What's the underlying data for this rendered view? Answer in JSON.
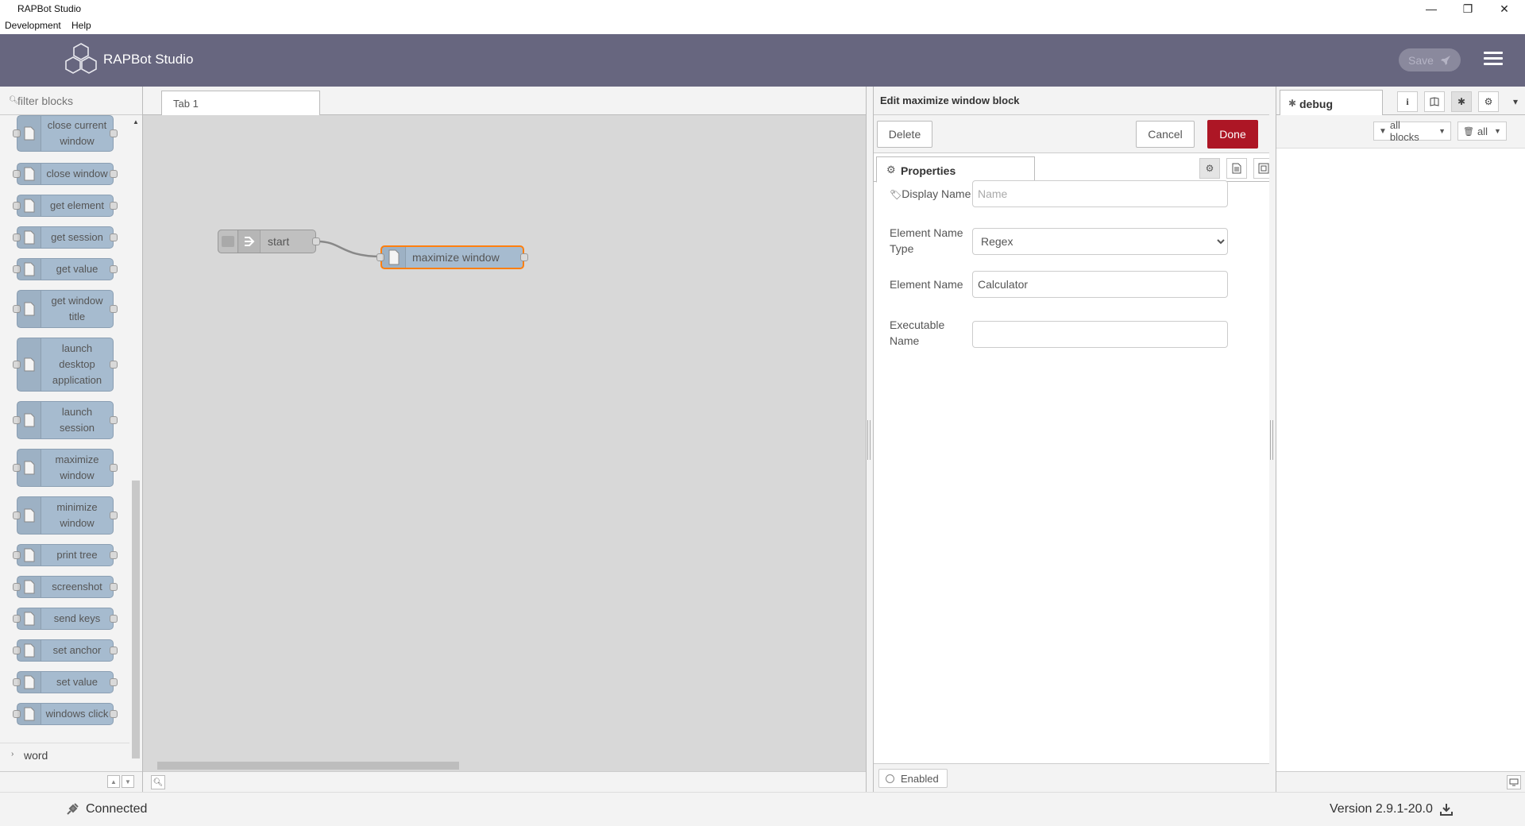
{
  "window": {
    "title": "RAPBot Studio",
    "minimize_glyph": "—",
    "restore_glyph": "❐",
    "close_glyph": "✕"
  },
  "menu": {
    "items": [
      "Development",
      "Help"
    ]
  },
  "header": {
    "app_name": "RAPBot Studio",
    "save_label": "Save",
    "icons": {
      "logo": "hexagon-logo-icon",
      "save": "rocket-icon",
      "menu": "hamburger-menu-icon"
    }
  },
  "palette": {
    "filter_placeholder": "filter blocks",
    "blocks": [
      {
        "label": "close current window"
      },
      {
        "label": "close window"
      },
      {
        "label": "get element"
      },
      {
        "label": "get session"
      },
      {
        "label": "get value"
      },
      {
        "label": "get window title"
      },
      {
        "label": "launch desktop application"
      },
      {
        "label": "launch session"
      },
      {
        "label": "maximize window"
      },
      {
        "label": "minimize window"
      },
      {
        "label": "print tree"
      },
      {
        "label": "screenshot"
      },
      {
        "label": "send keys"
      },
      {
        "label": "set anchor"
      },
      {
        "label": "set value"
      },
      {
        "label": "windows click"
      }
    ],
    "category": "word",
    "footer_up": "▲",
    "footer_down": "▼"
  },
  "workspace": {
    "tab_label": "Tab 1",
    "nodes": {
      "start_label": "start",
      "maximize_label": "maximize window"
    }
  },
  "editor": {
    "title": "Edit maximize window block",
    "delete_label": "Delete",
    "cancel_label": "Cancel",
    "done_label": "Done",
    "properties_tab": "Properties",
    "fields": {
      "display_name_label": "Display Name",
      "display_name_placeholder": "Name",
      "display_name_value": "",
      "element_name_type_label": "Element Name Type",
      "element_name_type_value": "Regex",
      "element_name_label": "Element Name",
      "element_name_value": "Calculator",
      "executable_name_label": "Executable Name",
      "executable_name_value": ""
    },
    "enabled_label": "Enabled",
    "done_color": "#ad1625"
  },
  "sidebar": {
    "debug_tab": "debug",
    "filter_all_blocks": "all blocks",
    "clear_all": "all",
    "icons": [
      "info-icon",
      "book-icon",
      "bug-icon",
      "gear-icon",
      "chevron-down-icon"
    ]
  },
  "status": {
    "connection": "Connected",
    "version": "Version 2.9.1-20.0"
  },
  "colors": {
    "header_bg": "#67667f",
    "block_fill": "#a6bbcf",
    "canvas_bg": "#d8d8d8"
  }
}
